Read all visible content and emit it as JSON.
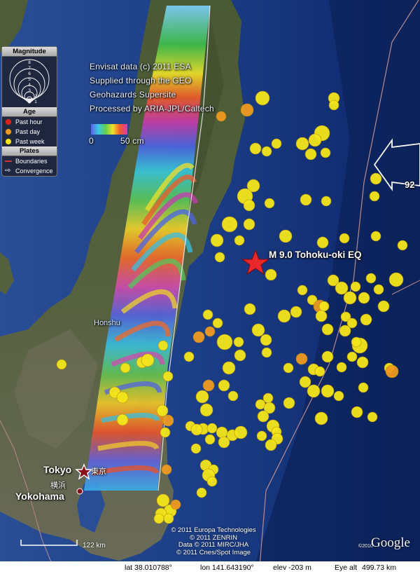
{
  "credits": {
    "line1": "Envisat data (c) 2011 ESA",
    "line2": "Supplied through the GEO",
    "line3": "Geohazards Supersite",
    "line4": "Processed by ARIA-JPL/Caltech"
  },
  "colorbar": {
    "min_label": "0",
    "max_label": "50 cm"
  },
  "legend": {
    "magnitude_title": "Magnitude",
    "magnitude_ticks": [
      "8",
      "7",
      "6",
      "5",
      "4",
      "3",
      "2",
      "1"
    ],
    "age_title": "Age",
    "age_items": [
      {
        "label": "Past hour",
        "color": "#e02020"
      },
      {
        "label": "Past day",
        "color": "#f09a20"
      },
      {
        "label": "Past week",
        "color": "#f4e61a"
      }
    ],
    "plates_title": "Plates",
    "plates_items": [
      {
        "label": "Boundaries",
        "icon": "red-line-icon"
      },
      {
        "label": "Convergence",
        "icon": "arrow-right-icon"
      }
    ]
  },
  "labels": {
    "epicenter": "M 9.0 Tohoku-oki EQ",
    "honshu": "Honshu",
    "tokyo": "Tokyo",
    "tokyo_jp": "東京",
    "yokohama_jp": "横浜",
    "yokohama": "Yokohama",
    "convergence_rate": "92",
    "scale": "122 km"
  },
  "copyright": {
    "line1": "© 2011 Europa Technologies",
    "line2": "© 2011 ZENRIN",
    "line3": "Data © 2011 MIRC/JHA",
    "line4": "© 2011 Cnes/Spot Image"
  },
  "google": {
    "logo": "Google",
    "year": "©2010"
  },
  "status": {
    "lat": "lat   38.010788°",
    "lon": "lon  141.643190°",
    "elev": "elev  -203 m",
    "eye_alt_label": "Eye alt",
    "eye_alt_value": "499.73 km"
  },
  "colors": {
    "past_hour": "#e02020",
    "past_day": "#f09a20",
    "past_week": "#f4e61a",
    "epicenter": "#e8282a",
    "ocean": "#0b2a66"
  }
}
